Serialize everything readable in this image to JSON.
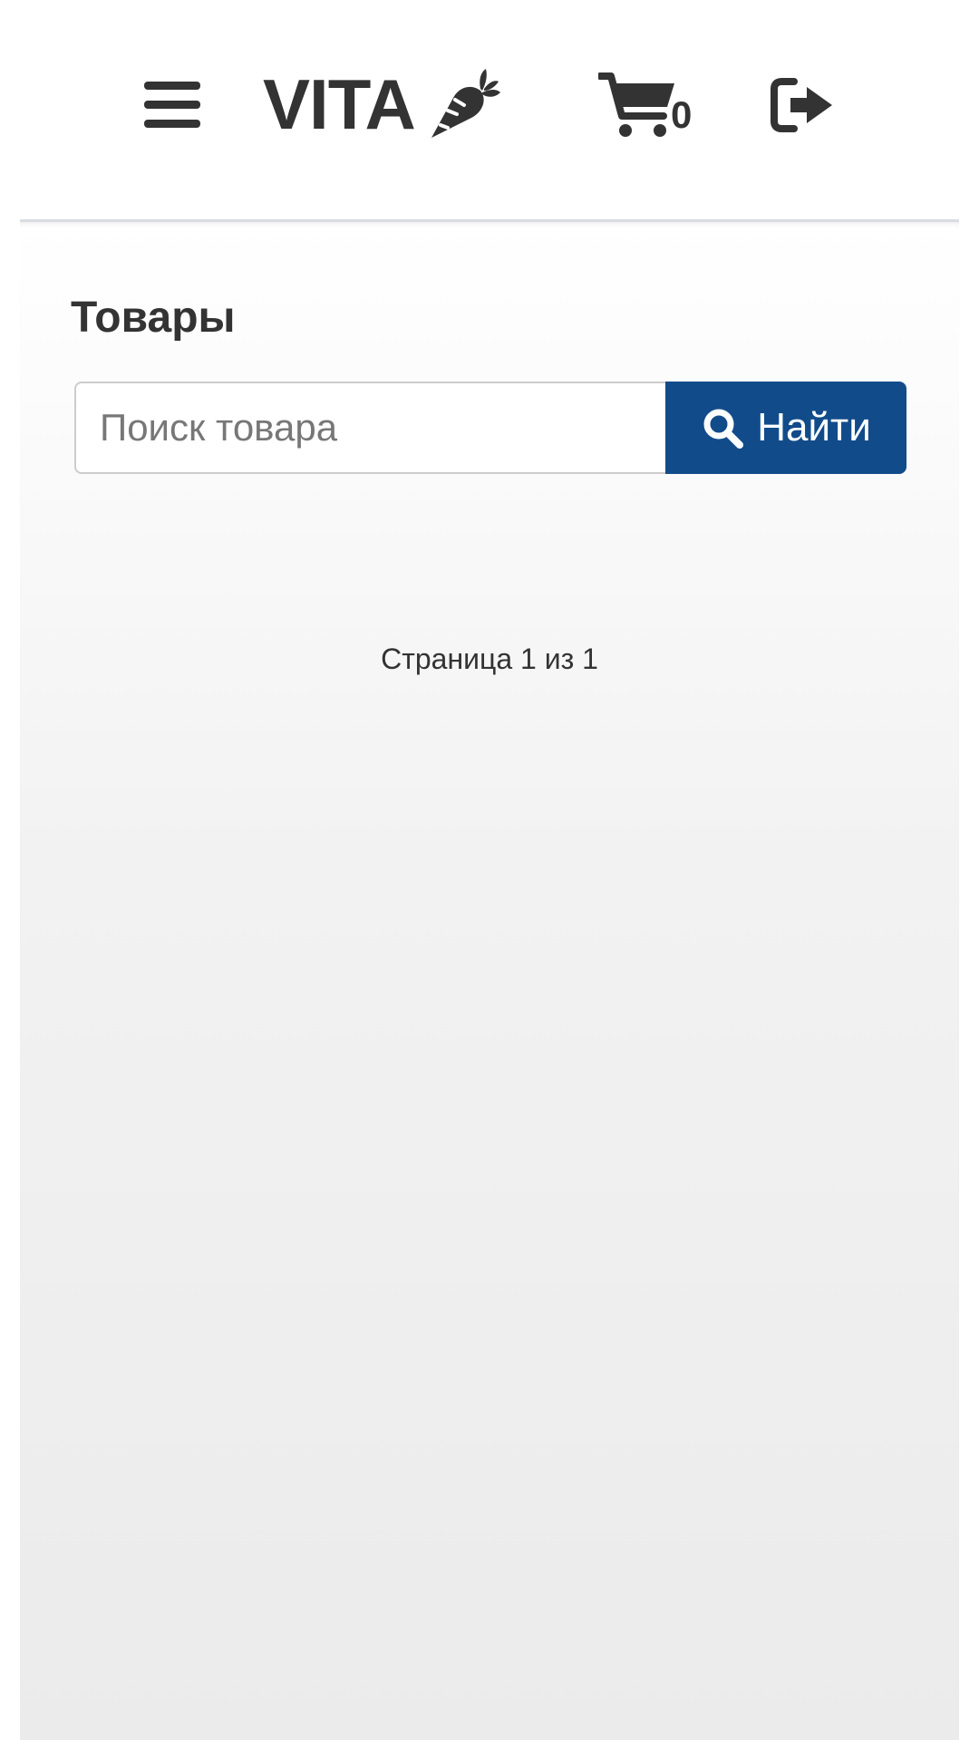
{
  "header": {
    "menu_icon": "hamburger-menu-icon",
    "logo_text": "VITA",
    "logo_icon": "carrot-icon",
    "cart_icon": "shopping-cart-icon",
    "cart_count": "0",
    "logout_icon": "sign-out-icon"
  },
  "main": {
    "title": "Товары",
    "search": {
      "placeholder": "Поиск товара",
      "value": "",
      "button_label": "Найти",
      "button_icon": "search-icon"
    },
    "pagination_text": "Страница 1 из 1"
  },
  "colors": {
    "accent": "#124b8a",
    "text": "#333333",
    "background_top": "#ffffff",
    "background_bottom": "#ebebeb"
  }
}
